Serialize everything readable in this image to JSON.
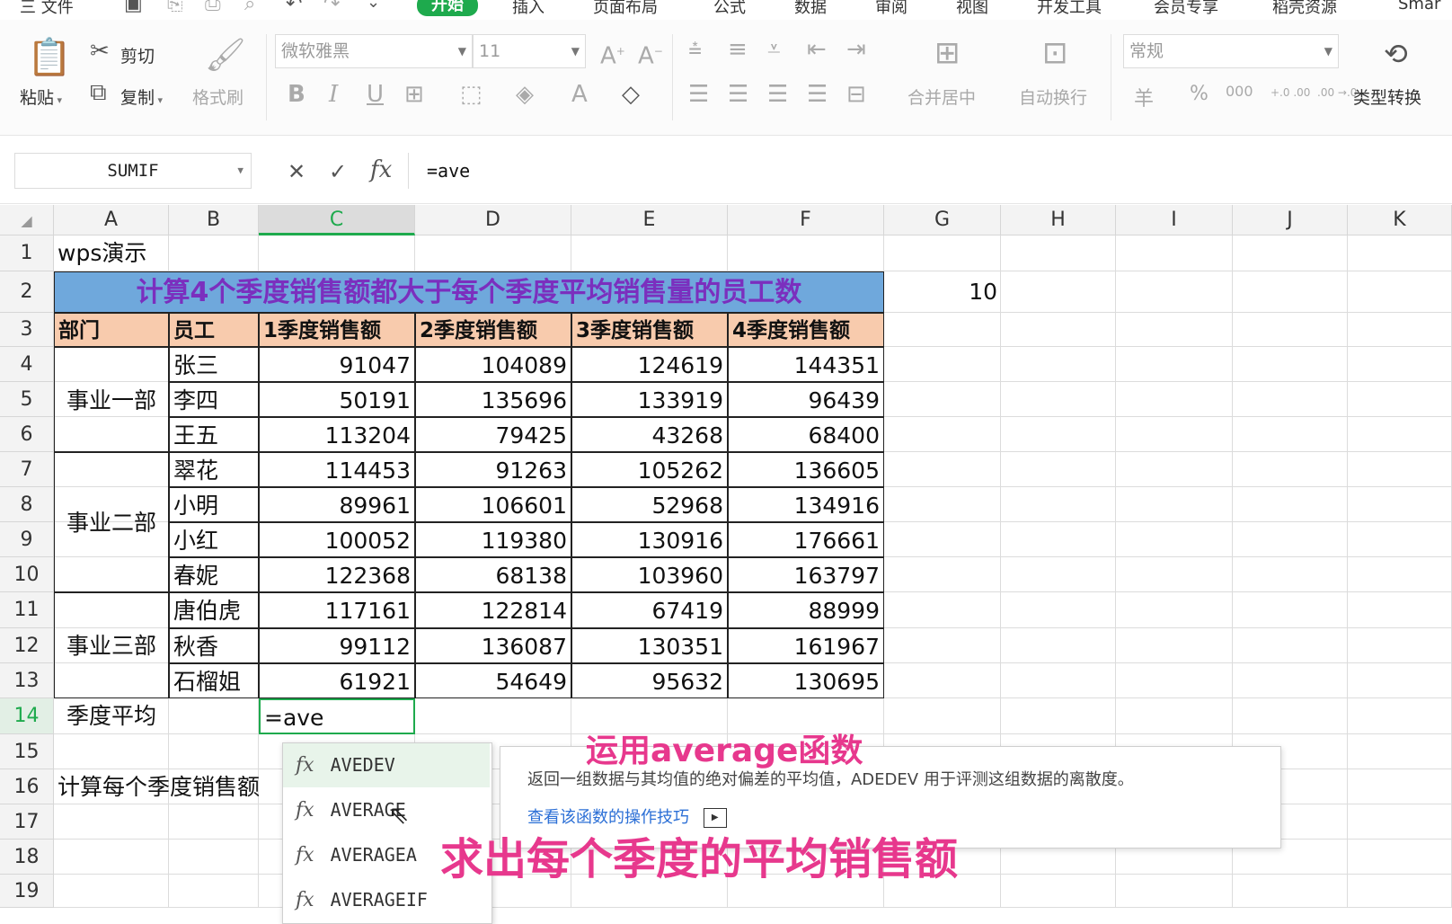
{
  "menu": {
    "items": [
      "三 文件",
      "开始",
      "插入",
      "页面布局",
      "公式",
      "数据",
      "审阅",
      "视图",
      "开发工具",
      "会员专享",
      "稻壳资源",
      "Smar"
    ]
  },
  "ribbon": {
    "paste": "粘贴",
    "cut": "剪切",
    "copy": "复制",
    "format_painter": "格式刷",
    "font_name": "微软雅黑",
    "font_size": "11",
    "merge_center": "合并居中",
    "wrap_text": "自动换行",
    "number_format": "常规",
    "type_convert": "类型转换",
    "currency_symbol": "羊",
    "percent": "%",
    "thousands": "000",
    "inc_decimal": "+.0 .00",
    "dec_decimal": ".00 →.0"
  },
  "formula_bar": {
    "name_box": "SUMIF",
    "formula": "=ave"
  },
  "columns": [
    "A",
    "B",
    "C",
    "D",
    "E",
    "F",
    "G",
    "H",
    "I",
    "J",
    "K"
  ],
  "rows": [
    "1",
    "2",
    "3",
    "4",
    "5",
    "6",
    "7",
    "8",
    "9",
    "10",
    "11",
    "12",
    "13",
    "14",
    "15",
    "16",
    "17",
    "18",
    "19"
  ],
  "sheet": {
    "a1": "wps演示",
    "title": "计算4个季度销售额都大于每个季度平均销售量的员工数",
    "g2": "10",
    "headers": [
      "部门",
      "员工",
      "1季度销售额",
      "2季度销售额",
      "3季度销售额",
      "4季度销售额"
    ],
    "departments": [
      "事业一部",
      "事业二部",
      "事业三部"
    ],
    "data": [
      [
        "张三",
        "91047",
        "104089",
        "124619",
        "144351"
      ],
      [
        "李四",
        "50191",
        "135696",
        "133919",
        "96439"
      ],
      [
        "王五",
        "113204",
        "79425",
        "43268",
        "68400"
      ],
      [
        "翠花",
        "114453",
        "91263",
        "105262",
        "136605"
      ],
      [
        "小明",
        "89961",
        "106601",
        "52968",
        "134916"
      ],
      [
        "小红",
        "100052",
        "119380",
        "130916",
        "176661"
      ],
      [
        "春妮",
        "122368",
        "68138",
        "103960",
        "163797"
      ],
      [
        "唐伯虎",
        "117161",
        "122814",
        "67419",
        "88999"
      ],
      [
        "秋香",
        "99112",
        "136087",
        "130351",
        "161967"
      ],
      [
        "石榴姐",
        "61921",
        "54649",
        "95632",
        "130695"
      ]
    ],
    "a14": "季度平均",
    "c14": "=ave",
    "a16": "计算每个季度销售额"
  },
  "autocomplete": {
    "items": [
      "AVEDEV",
      "AVERAGE",
      "AVERAGEA",
      "AVERAGEIF"
    ],
    "tip_desc": "返回一组数据与其均值的绝对偏差的平均值，ADEDEV 用于评测这组数据的离散度。",
    "tip_link": "查看该函数的操作技巧"
  },
  "overlay": {
    "caption1": "运用average函数",
    "caption2": "求出每个季度的平均销售额"
  },
  "colors": {
    "accent": "#1eaa4d",
    "title_bg": "#6fa8dc",
    "title_text": "#7b2fbe",
    "header_bg": "#f8cbad",
    "overlay_text": "#e7388d"
  }
}
